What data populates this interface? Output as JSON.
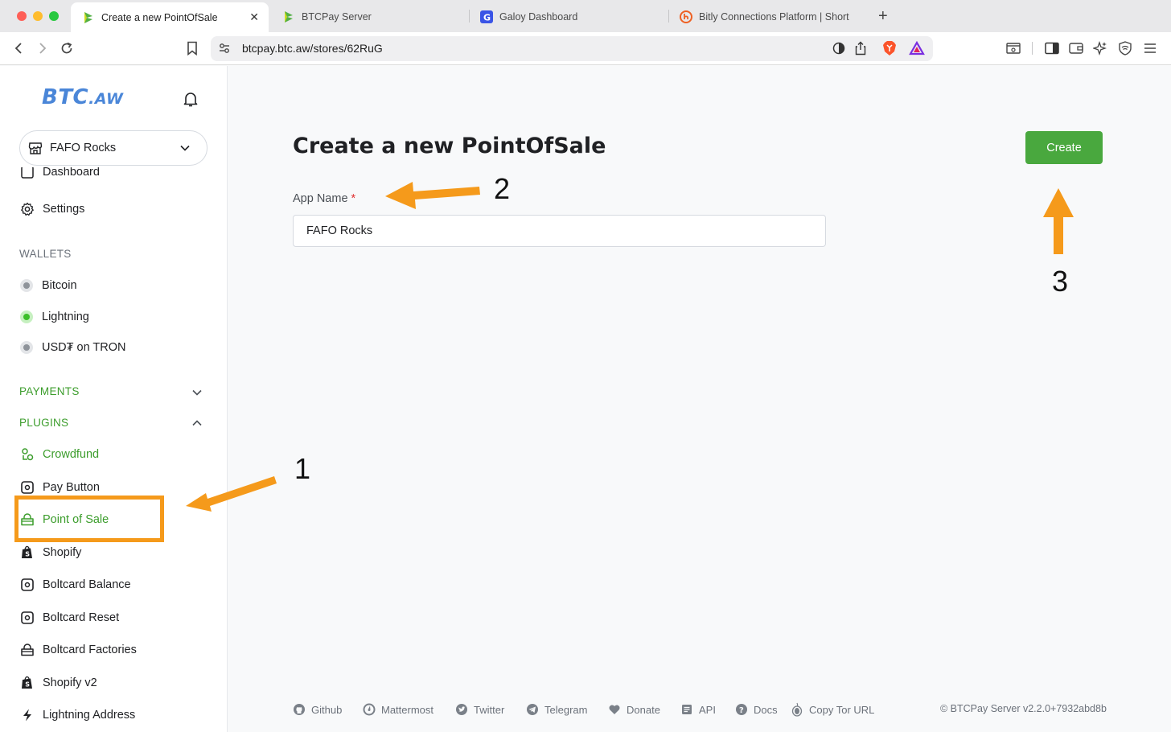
{
  "browser": {
    "tabs": [
      {
        "title": "Create a new PointOfSale",
        "active": true
      },
      {
        "title": "BTCPay Server",
        "active": false
      },
      {
        "title": "Galoy Dashboard",
        "active": false
      },
      {
        "title": "Bitly Connections Platform | Short",
        "active": false
      }
    ],
    "new_tab_label": "+",
    "close_label": "✕",
    "url": "btcpay.btc.aw/stores/62RuG"
  },
  "sidebar": {
    "logo_main": "BTC",
    "logo_suffix": ".AW",
    "store_name": "FAFO Rocks",
    "nav_partial": "Dashboard",
    "nav_settings": "Settings",
    "wallets_header": "WALLETS",
    "wallets": [
      {
        "label": "Bitcoin",
        "status": "inactive"
      },
      {
        "label": "Lightning",
        "status": "active"
      },
      {
        "label": "USD₮ on TRON",
        "status": "inactive"
      }
    ],
    "payments_header": "PAYMENTS",
    "plugins_header": "PLUGINS",
    "plugins": [
      {
        "label": "Crowdfund",
        "icon": "crowdfund-icon"
      },
      {
        "label": "Pay Button",
        "icon": "pay-button-icon"
      },
      {
        "label": "Point of Sale",
        "icon": "point-of-sale-icon"
      },
      {
        "label": "Shopify",
        "icon": "shopify-icon"
      },
      {
        "label": "Boltcard Balance",
        "icon": "boltcard-icon"
      },
      {
        "label": "Boltcard Reset",
        "icon": "boltcard-icon"
      },
      {
        "label": "Boltcard Factories",
        "icon": "factory-icon"
      },
      {
        "label": "Shopify v2",
        "icon": "shopify-icon"
      },
      {
        "label": "Lightning Address",
        "icon": "lightning-icon"
      }
    ]
  },
  "main": {
    "title": "Create a new PointOfSale",
    "create_button": "Create",
    "app_name_label": "App Name",
    "required_marker": "*",
    "app_name_value": "FAFO Rocks"
  },
  "footer": {
    "links": [
      "Github",
      "Mattermost",
      "Twitter",
      "Telegram",
      "Donate",
      "API",
      "Docs",
      "Copy Tor URL"
    ],
    "copyright": "© BTCPay Server v2.2.0+7932abd8b"
  },
  "annotations": {
    "step1": "1",
    "step2": "2",
    "step3": "3",
    "color": "#f59a1b"
  },
  "colors": {
    "brand_green": "#49a83e",
    "nav_green": "#3c9d2c",
    "logo_blue": "#4a86d8"
  }
}
